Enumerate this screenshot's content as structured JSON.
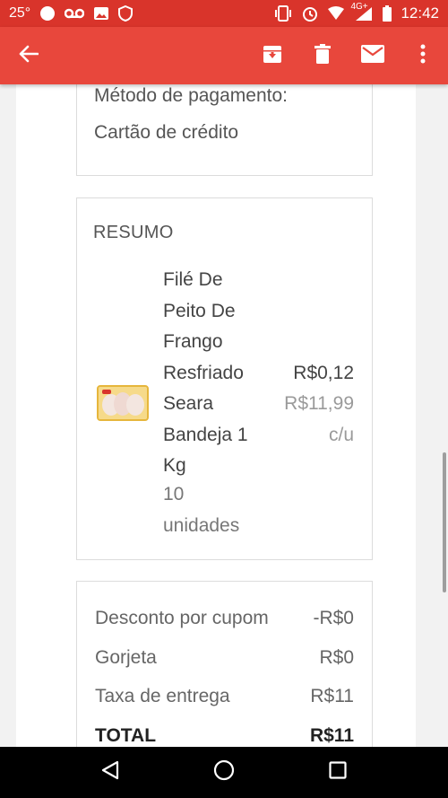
{
  "status_bar": {
    "temperature": "25°",
    "network_label": "4G+",
    "time": "12:42"
  },
  "app_bar": {
    "icons": [
      "back-arrow-icon",
      "archive-icon",
      "delete-icon",
      "mail-icon",
      "more-vert-icon"
    ]
  },
  "payment": {
    "label": "Método de pagamento:",
    "value": "Cartão de crédito"
  },
  "summary": {
    "title": "RESUMO",
    "item": {
      "name_lines": [
        "Filé De",
        "Peito De",
        "Frango",
        "Resfriado",
        "Seara",
        "Bandeja 1",
        "Kg"
      ],
      "qty_lines": [
        "10",
        "unidades"
      ],
      "price": "R$0,12",
      "unit_price": "R$11,99",
      "per_unit": "c/u"
    }
  },
  "totals": {
    "rows": [
      {
        "label": "Desconto por cupom",
        "value": "-R$0"
      },
      {
        "label": "Gorjeta",
        "value": "R$0"
      },
      {
        "label": "Taxa de entrega",
        "value": "R$11"
      }
    ],
    "total_label": "TOTAL",
    "total_value": "R$11"
  },
  "nav_bar": {
    "icons": [
      "nav-back-icon",
      "nav-home-icon",
      "nav-recents-icon"
    ]
  },
  "colors": {
    "status_bar": "#d9342b",
    "app_bar": "#e8473c"
  }
}
